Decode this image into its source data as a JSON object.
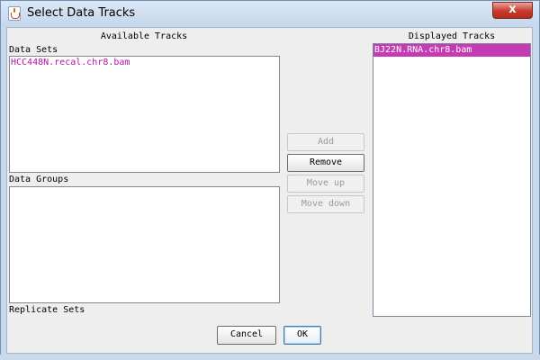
{
  "window": {
    "title": "Select Data Tracks",
    "close_glyph": "x"
  },
  "colors": {
    "track_text": "#b016a3",
    "selection_bg": "#c43bb4",
    "titlebar": "#c9d9ec",
    "close_button": "#c7392b"
  },
  "icons": {
    "app": "java-coffee-cup-icon",
    "close": "close-icon"
  },
  "available": {
    "header": "Available Tracks",
    "data_sets_label": "Data Sets",
    "data_sets": [
      "HCC448N.recal.chr8.bam"
    ],
    "data_groups_label": "Data Groups",
    "data_groups": [],
    "replicate_sets_label": "Replicate Sets"
  },
  "displayed": {
    "header": "Displayed Tracks",
    "items": [
      "BJ22N.RNA.chr8.bam"
    ],
    "selected_index": 0
  },
  "buttons": {
    "add": "Add",
    "remove": "Remove",
    "move_up": "Move up",
    "move_down": "Move down",
    "cancel": "Cancel",
    "ok": "OK"
  }
}
